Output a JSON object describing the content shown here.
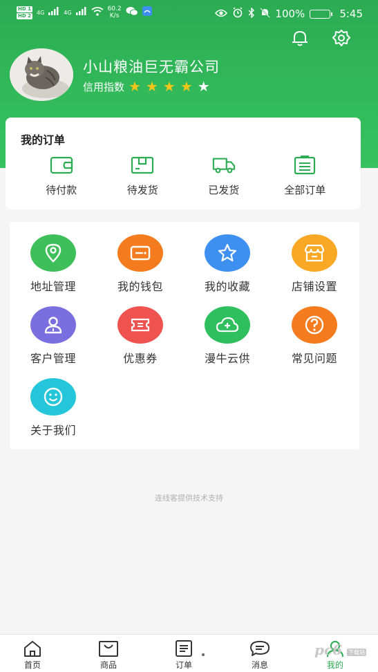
{
  "status_bar": {
    "sim1": "HD 1",
    "sim2": "HD 2",
    "signal1": "4G",
    "signal2": "4G",
    "net_speed_value": "60.2",
    "net_speed_unit": "K/s",
    "battery": "100%",
    "time": "5:45"
  },
  "header": {
    "company_name": "小山粮油巨无霸公司",
    "credit_label": "信用指数",
    "credit_rating": 4,
    "credit_max": 5
  },
  "orders": {
    "title": "我的订单",
    "items": [
      {
        "label": "待付款",
        "icon": "wallet-icon"
      },
      {
        "label": "待发货",
        "icon": "package-icon"
      },
      {
        "label": "已发货",
        "icon": "truck-icon"
      },
      {
        "label": "全部订单",
        "icon": "list-icon"
      }
    ]
  },
  "tools": [
    {
      "label": "地址管理",
      "icon": "location-icon",
      "color": "#3fbf5a"
    },
    {
      "label": "我的钱包",
      "icon": "wallet-icon",
      "color": "#f57c1e"
    },
    {
      "label": "我的收藏",
      "icon": "star-icon",
      "color": "#3d8ff0"
    },
    {
      "label": "店铺设置",
      "icon": "store-icon",
      "color": "#f9a825"
    },
    {
      "label": "客户管理",
      "icon": "user-icon",
      "color": "#7b6fe0"
    },
    {
      "label": "优惠券",
      "icon": "coupon-icon",
      "color": "#ef5350"
    },
    {
      "label": "漫牛云供",
      "icon": "cloud-icon",
      "color": "#2fbf5e"
    },
    {
      "label": "常见问题",
      "icon": "question-icon",
      "color": "#f57c1e"
    },
    {
      "label": "关于我们",
      "icon": "smile-icon",
      "color": "#26c6da"
    }
  ],
  "footer_note": "连线客提供技术支持",
  "tabbar": {
    "tabs": [
      {
        "label": "首页",
        "icon": "home-icon",
        "active": false
      },
      {
        "label": "商品",
        "icon": "bag-icon",
        "active": false
      },
      {
        "label": "订单",
        "icon": "order-icon",
        "active": false
      },
      {
        "label": "消息",
        "icon": "message-icon",
        "active": false
      },
      {
        "label": "我的",
        "icon": "profile-icon",
        "active": true
      }
    ]
  },
  "watermark": {
    "text": "pc6",
    "sub": "下载站"
  },
  "colors": {
    "brand": "#2bab52",
    "accent_star": "#f5c518"
  }
}
